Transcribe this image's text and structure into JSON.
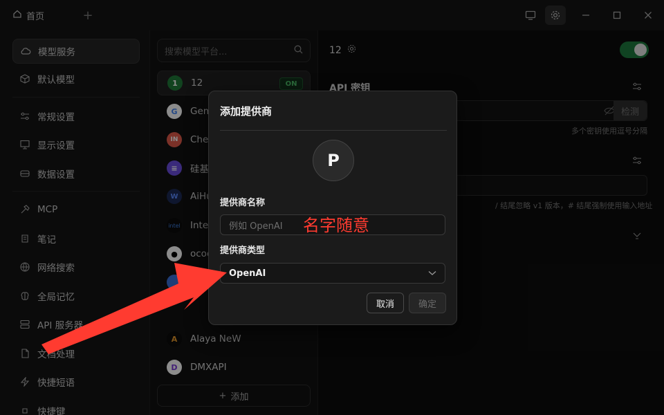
{
  "titlebar": {
    "home_tab": "首页",
    "add_tab_icon": "plus-icon",
    "icons": [
      "monitor-icon",
      "gear-icon",
      "minimize-icon",
      "maximize-icon",
      "close-icon"
    ]
  },
  "sidebar": {
    "items": [
      {
        "label": "模型服务",
        "icon": "cloud-icon",
        "active": true
      },
      {
        "label": "默认模型",
        "icon": "cube-icon"
      },
      {
        "label": "常规设置",
        "icon": "sliders-icon"
      },
      {
        "label": "显示设置",
        "icon": "display-icon"
      },
      {
        "label": "数据设置",
        "icon": "drive-icon"
      },
      {
        "label": "MCP",
        "icon": "hammer-icon"
      },
      {
        "label": "笔记",
        "icon": "note-icon"
      },
      {
        "label": "网络搜索",
        "icon": "globe-icon"
      },
      {
        "label": "全局记忆",
        "icon": "brain-icon"
      },
      {
        "label": "API 服务器",
        "icon": "server-icon"
      },
      {
        "label": "文档处理",
        "icon": "document-icon"
      },
      {
        "label": "快捷短语",
        "icon": "zap-icon"
      },
      {
        "label": "快捷键",
        "icon": "command-icon"
      }
    ]
  },
  "providers": {
    "search_placeholder": "搜索模型平台...",
    "items": [
      {
        "name": "12",
        "logo": "1",
        "color": "#1f7a3a",
        "on": "ON",
        "active": true
      },
      {
        "name": "Gemini",
        "logo": "G",
        "color": "#ffffff"
      },
      {
        "name": "Cherry",
        "logo": "IN",
        "color": "#e05a4a"
      },
      {
        "name": "硅基流动",
        "logo": "≡",
        "color": "#6a4de0"
      },
      {
        "name": "AiHubMix",
        "logo": "W",
        "color": "#2a5bd7"
      },
      {
        "name": "Intel",
        "logo": "intel",
        "color": "#0b0b0b"
      },
      {
        "name": "ocoolAI",
        "logo": "●",
        "color": "#ffffff"
      },
      {
        "name": "",
        "logo": "",
        "color": "#3a6fd8"
      },
      {
        "name": "",
        "logo": "",
        "color": "#ffffff"
      },
      {
        "name": "Alaya NeW",
        "logo": "A",
        "color": "#0b0b0b"
      },
      {
        "name": "DMXAPI",
        "logo": "D",
        "color": "#ffffff"
      }
    ],
    "add_label": "添加"
  },
  "main": {
    "provider_name": "12",
    "api_key_label": "API 密钥",
    "check_label": "检测",
    "key_hint": "多个密钥使用逗号分隔",
    "url_hint": "/ 结尾忽略 v1 版本，# 结尾强制使用输入地址"
  },
  "modal": {
    "title": "添加提供商",
    "avatar_letter": "P",
    "name_label": "提供商名称",
    "name_placeholder": "例如 OpenAI",
    "annotation": "名字随意",
    "type_label": "提供商类型",
    "type_value": "OpenAI",
    "cancel_label": "取消",
    "ok_label": "确定"
  },
  "colors": {
    "accent_green": "#1e7b3f",
    "annotation_red": "#ff3b30"
  }
}
